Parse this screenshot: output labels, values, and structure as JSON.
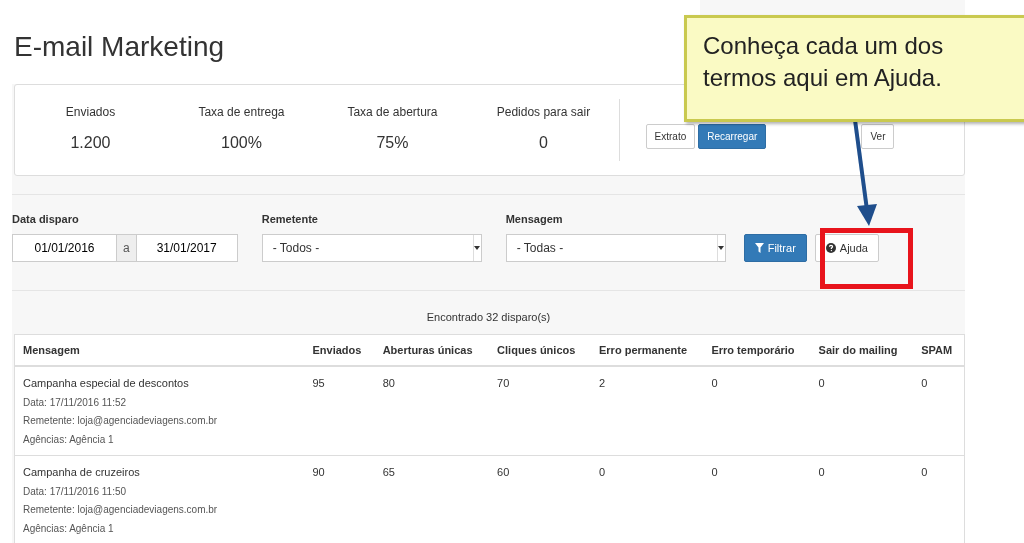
{
  "title": "E-mail Marketing",
  "stats": [
    {
      "label": "Enviados",
      "value": "1.200"
    },
    {
      "label": "Taxa de entrega",
      "value": "100%"
    },
    {
      "label": "Taxa de abertura",
      "value": "75%"
    },
    {
      "label": "Pedidos para sair",
      "value": "0"
    }
  ],
  "credits": {
    "buttons": [
      {
        "label": "Extrato",
        "kind": "default"
      },
      {
        "label": "Recarregar",
        "kind": "primary"
      }
    ]
  },
  "automations": {
    "buttons": [
      {
        "label": "Ver",
        "kind": "default"
      }
    ]
  },
  "filters": {
    "date_label": "Data disparo",
    "date_from": "01/01/2016",
    "date_sep": "a",
    "date_to": "31/01/2017",
    "sender_label": "Remetente",
    "sender_value": "- Todos -",
    "message_label": "Mensagem",
    "message_value": "- Todas -",
    "filter_button": "Filtrar",
    "help_button": "Ajuda"
  },
  "found": "Encontrado 32 disparo(s)",
  "table": {
    "columns": [
      "Mensagem",
      "Enviados",
      "Aberturas únicas",
      "Cliques únicos",
      "Erro permanente",
      "Erro temporário",
      "Sair do mailing",
      "SPAM"
    ],
    "rows": [
      {
        "details": [
          "Data: 17/11/2016 11:52",
          "Remetente: loja@agenciadeviagens.com.br",
          "Agências: Agência 1"
        ],
        "cells": [
          "Campanha especial de descontos",
          "95",
          "80",
          "70",
          "2",
          "0",
          "0",
          "0"
        ]
      },
      {
        "details": [
          "Data: 17/11/2016 11:50",
          "Remetente: loja@agenciadeviagens.com.br",
          "Agências: Agência 1"
        ],
        "cells": [
          "Campanha de cruzeiros",
          "90",
          "65",
          "60",
          "0",
          "0",
          "0",
          "0"
        ]
      }
    ]
  },
  "callout": "Conheça cada um dos termos aqui em Ajuda."
}
